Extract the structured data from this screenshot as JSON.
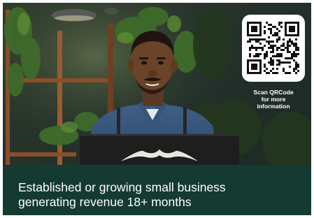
{
  "qr": {
    "line1": "Scan QRCode",
    "line2": "for more",
    "line3": "information"
  },
  "caption": {
    "line1": "Established or growing small business",
    "line2": "generating revenue 18+ months"
  },
  "colors": {
    "caption_band": "#143a32",
    "caption_text": "#ffffff",
    "qr_background": "#ffffff",
    "qr_modules": "#111111"
  },
  "icons": {
    "mustache": "mustache-icon",
    "qr": "qr-code-icon"
  }
}
